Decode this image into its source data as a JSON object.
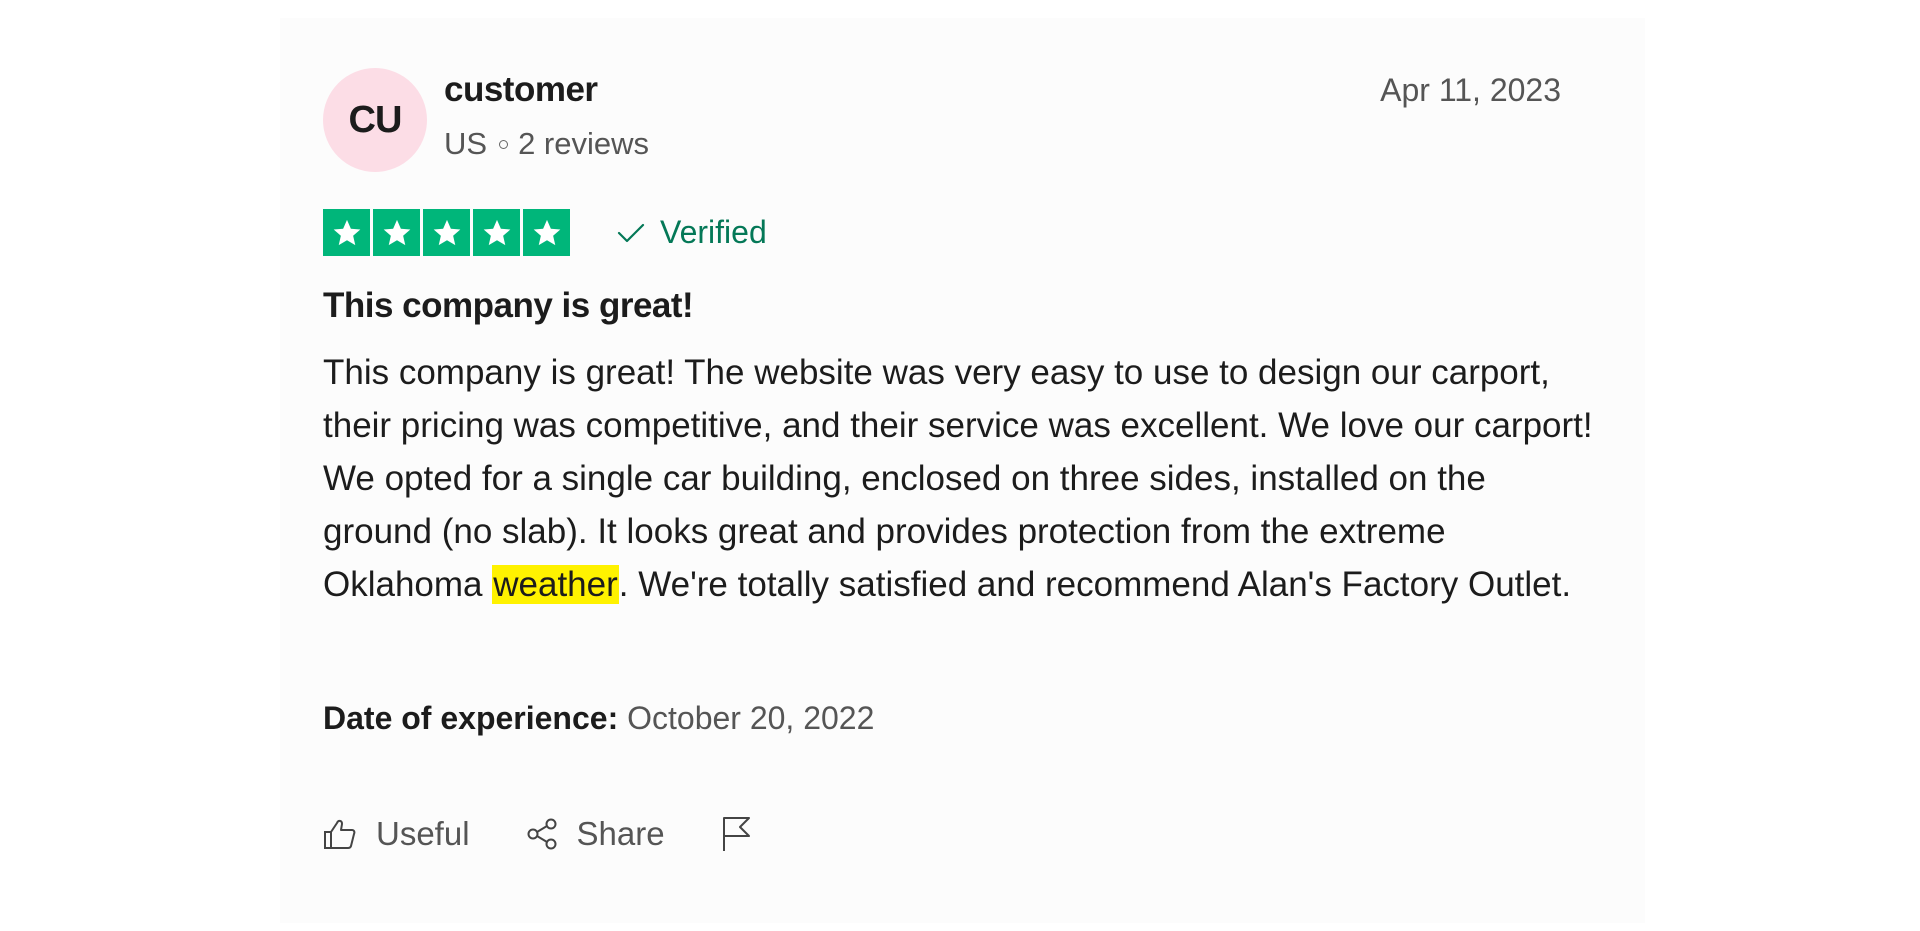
{
  "review": {
    "avatar_initials": "CU",
    "reviewer_name": "customer",
    "reviewer_country": "US",
    "reviewer_review_count": "2 reviews",
    "date": "Apr 11, 2023",
    "rating": 5,
    "rating_color": "#00b67a",
    "verified_label": "Verified",
    "title": "This company is great!",
    "body_before": "This company is great! The website was very easy to use to design our carport, their pricing was competitive, and their service was excellent. We love our carport! We opted for a single car building, enclosed on three sides, installed on the ground (no slab). It looks great and provides protection from the extreme Oklahoma ",
    "body_highlight": "weather",
    "body_after": ". We're totally satisfied and recommend Alan's Factory Outlet.",
    "experience_label": "Date of experience:",
    "experience_date": "October 20, 2022"
  },
  "actions": {
    "useful_label": "Useful",
    "share_label": "Share",
    "useful_icon": "thumbs-up-icon",
    "share_icon": "share-icon",
    "flag_icon": "flag-icon"
  }
}
